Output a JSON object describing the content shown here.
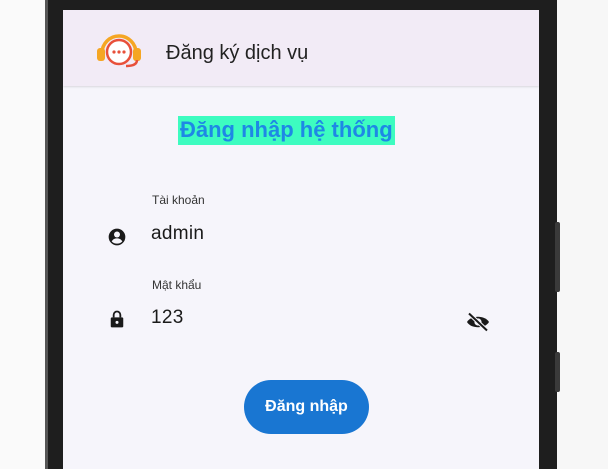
{
  "appbar": {
    "title": "Đăng ký dịch vụ",
    "logo_icon": "headset-chat-logo"
  },
  "heading": "Đăng nhập hệ thống",
  "username": {
    "label": "Tài khoản",
    "value": "admin",
    "icon": "account-circle-icon"
  },
  "password": {
    "label": "Mật khẩu",
    "value": "123",
    "icon": "lock-icon",
    "toggle_icon": "visibility-off-icon"
  },
  "login_button": {
    "label": "Đăng nhập"
  },
  "colors": {
    "appbar_bg": "#f2ebf6",
    "heading_bg": "#3dfcc0",
    "heading_text": "#1e88e5",
    "button_bg": "#1976d2",
    "logo_orange": "#f5a623",
    "logo_red": "#e8503a"
  }
}
